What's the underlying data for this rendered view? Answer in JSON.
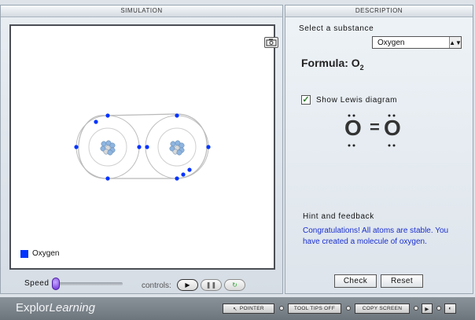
{
  "simulation_panel": {
    "header": "SIMULATION",
    "legend_label": "Oxygen",
    "legend_color": "#0033ff",
    "speed_label": "Speed",
    "controls_label": "controls:"
  },
  "description_panel": {
    "header": "DESCRIPTION",
    "select_label": "Select a substance",
    "substance_value": "Oxygen",
    "formula_label": "Formula: O",
    "formula_subscript": "2",
    "show_lewis_label": "Show Lewis diagram",
    "show_lewis_checked": true,
    "lewis_left_atom": "O",
    "lewis_bond": "=",
    "lewis_right_atom": "O",
    "hint_label": "Hint and feedback",
    "feedback_text": "Congratulations! All atoms are stable. You have created a molecule of oxygen.",
    "check_label": "Check",
    "reset_label": "Reset"
  },
  "footer": {
    "brand_part1": "Explor",
    "brand_part2": "Learning",
    "pointer_label": "POINTER",
    "tooltips_label": "TOOL TIPS OFF",
    "copy_label": "COPY SCREEN"
  },
  "colors": {
    "electron": "#0033ff",
    "feedback": "#1a2fd0"
  }
}
